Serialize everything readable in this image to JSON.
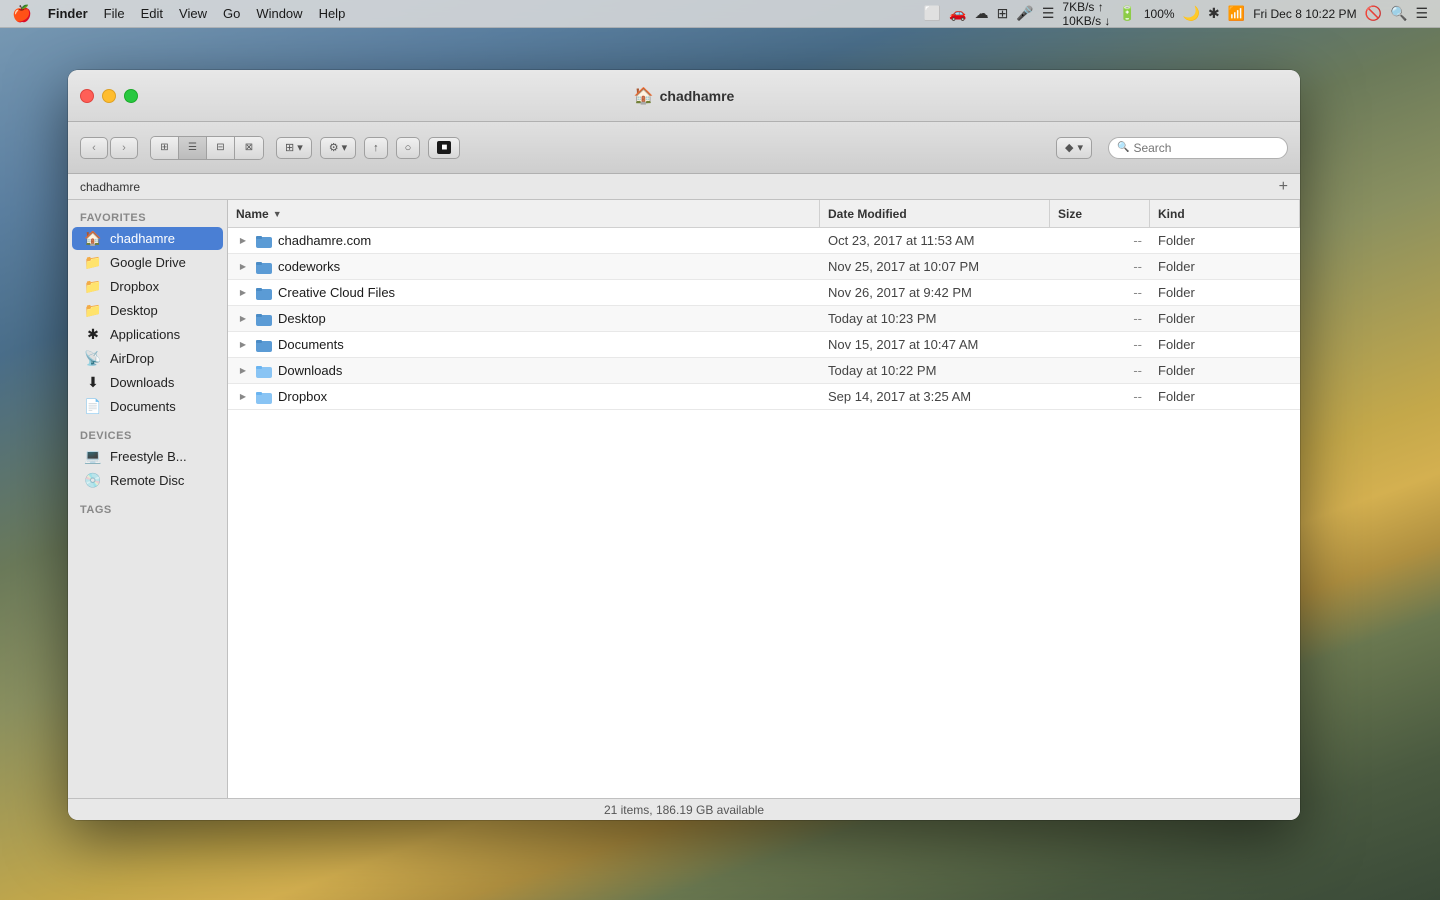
{
  "desktop": {
    "bg_description": "macOS High Sierra mountain wallpaper"
  },
  "menubar": {
    "apple_symbol": "🍎",
    "items": [
      "Finder",
      "File",
      "Edit",
      "View",
      "Go",
      "Window",
      "Help"
    ],
    "finder_bold": true,
    "right_items": [
      "7KB/s",
      "10KB/s",
      "100%",
      "Fri Dec 8  10:22 PM"
    ],
    "battery": "100%"
  },
  "window": {
    "title": "chadhamre",
    "title_icon": "🏠"
  },
  "toolbar": {
    "back_label": "‹",
    "forward_label": "›",
    "view_icons": [
      "⊞",
      "☰",
      "⊟",
      "⊠"
    ],
    "action_icon": "⊞",
    "share_icon": "↑",
    "tag_icon": "○",
    "terminal_icon": "■",
    "dropbox_label": "▾",
    "search_placeholder": "Search",
    "search_icon": "🔍"
  },
  "pathbar": {
    "label": "chadhamre",
    "add_icon": "+"
  },
  "sidebar": {
    "sections": [
      {
        "label": "Favorites",
        "items": [
          {
            "id": "chadhamre",
            "label": "chadhamre",
            "icon": "🏠",
            "active": true
          },
          {
            "id": "google-drive",
            "label": "Google Drive",
            "icon": "📁"
          },
          {
            "id": "dropbox",
            "label": "Dropbox",
            "icon": "📁"
          },
          {
            "id": "desktop",
            "label": "Desktop",
            "icon": "📁"
          },
          {
            "id": "applications",
            "label": "Applications",
            "icon": "✱"
          },
          {
            "id": "airdrop",
            "label": "AirDrop",
            "icon": "📡"
          },
          {
            "id": "downloads",
            "label": "Downloads",
            "icon": "⬇"
          },
          {
            "id": "documents",
            "label": "Documents",
            "icon": "📄"
          }
        ]
      },
      {
        "label": "Devices",
        "items": [
          {
            "id": "freestyle-b",
            "label": "Freestyle B...",
            "icon": "💻"
          },
          {
            "id": "remote-disc",
            "label": "Remote Disc",
            "icon": "💿"
          }
        ]
      },
      {
        "label": "Tags",
        "items": []
      }
    ]
  },
  "columns": {
    "name": {
      "label": "Name",
      "sort_arrow": "▼"
    },
    "date_modified": {
      "label": "Date Modified"
    },
    "size": {
      "label": "Size"
    },
    "kind": {
      "label": "Kind"
    }
  },
  "files": [
    {
      "name": "chadhamre.com",
      "icon": "📁",
      "icon_color": "blue",
      "date": "Oct 23, 2017 at 11:53 AM",
      "size": "--",
      "kind": "Folder"
    },
    {
      "name": "codeworks",
      "icon": "📁",
      "icon_color": "blue",
      "date": "Nov 25, 2017 at 10:07 PM",
      "size": "--",
      "kind": "Folder"
    },
    {
      "name": "Creative Cloud Files",
      "icon": "📁",
      "icon_color": "blue",
      "date": "Nov 26, 2017 at 9:42 PM",
      "size": "--",
      "kind": "Folder"
    },
    {
      "name": "Desktop",
      "icon": "📁",
      "icon_color": "blue",
      "date": "Today at 10:23 PM",
      "size": "--",
      "kind": "Folder"
    },
    {
      "name": "Documents",
      "icon": "📁",
      "icon_color": "blue",
      "date": "Nov 15, 2017 at 10:47 AM",
      "size": "--",
      "kind": "Folder"
    },
    {
      "name": "Downloads",
      "icon": "📁",
      "icon_color": "light",
      "date": "Today at 10:22 PM",
      "size": "--",
      "kind": "Folder"
    },
    {
      "name": "Dropbox",
      "icon": "📁",
      "icon_color": "light",
      "date": "Sep 14, 2017 at 3:25 AM",
      "size": "--",
      "kind": "Folder"
    }
  ],
  "statusbar": {
    "label": "21 items, 186.19 GB available"
  }
}
